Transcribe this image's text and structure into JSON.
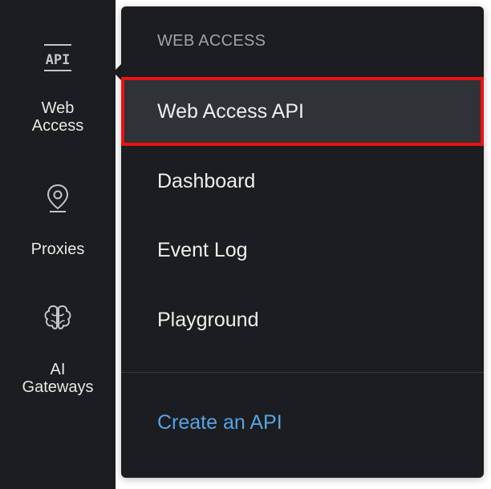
{
  "sidebar": {
    "items": [
      {
        "label": "Web\nAccess",
        "icon": "api-icon"
      },
      {
        "label": "Proxies",
        "icon": "location-pin-icon"
      },
      {
        "label": "AI\nGateways",
        "icon": "brain-icon"
      }
    ]
  },
  "flyout": {
    "section_title": "WEB ACCESS",
    "items": [
      {
        "label": "Web Access API",
        "active": true
      },
      {
        "label": "Dashboard"
      },
      {
        "label": "Event Log"
      },
      {
        "label": "Playground"
      }
    ],
    "create_link": "Create an API"
  },
  "colors": {
    "background": "#1b1d20",
    "active_item": "#2f3236",
    "highlight_border": "#ee1111",
    "link": "#56a4e6",
    "section_title": "#9ea2a8"
  }
}
